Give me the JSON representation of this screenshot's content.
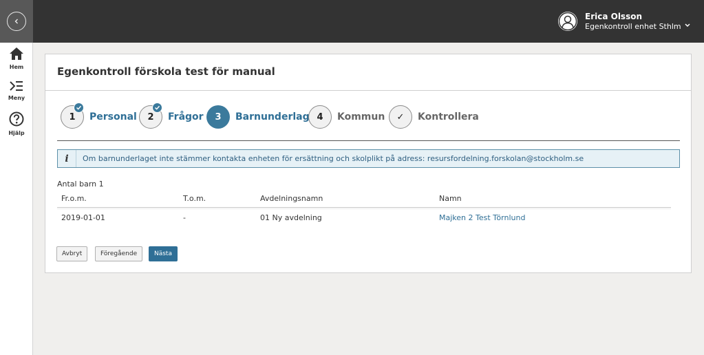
{
  "rail": {
    "items": [
      {
        "label": "Hem",
        "icon": "home-icon"
      },
      {
        "label": "Meny",
        "icon": "menu-icon"
      },
      {
        "label": "Hjälp",
        "icon": "help-icon"
      }
    ]
  },
  "user": {
    "name": "Erica Olsson",
    "unit": "Egenkontroll enhet Sthlm"
  },
  "page": {
    "title": "Egenkontroll förskola test för manual"
  },
  "steps": [
    {
      "number": "1",
      "label": "Personal",
      "state": "done"
    },
    {
      "number": "2",
      "label": "Frågor",
      "state": "done"
    },
    {
      "number": "3",
      "label": "Barnunderlag",
      "state": "active"
    },
    {
      "number": "4",
      "label": "Kommun",
      "state": "todo"
    },
    {
      "number": "✓",
      "label": "Kontrollera",
      "state": "todo"
    }
  ],
  "info": {
    "text": "Om barnunderlaget inte stämmer kontakta enheten för ersättning och skolplikt på adress: resursfordelning.forskolan@stockholm.se"
  },
  "table": {
    "count_label": "Antal barn 1",
    "columns": [
      "Fr.o.m.",
      "T.o.m.",
      "Avdelningsnamn",
      "Namn"
    ],
    "rows": [
      [
        "2019-01-01",
        "-",
        "01 Ny avdelning",
        "Majken 2 Test Törnlund"
      ]
    ]
  },
  "buttons": {
    "cancel": "Avbryt",
    "previous": "Föregående",
    "next": "Nästa"
  },
  "colors": {
    "accent": "#2f6f96",
    "active_step": "#3b7a9c",
    "topbar": "#333333",
    "info_bg": "#e6f1f6"
  }
}
